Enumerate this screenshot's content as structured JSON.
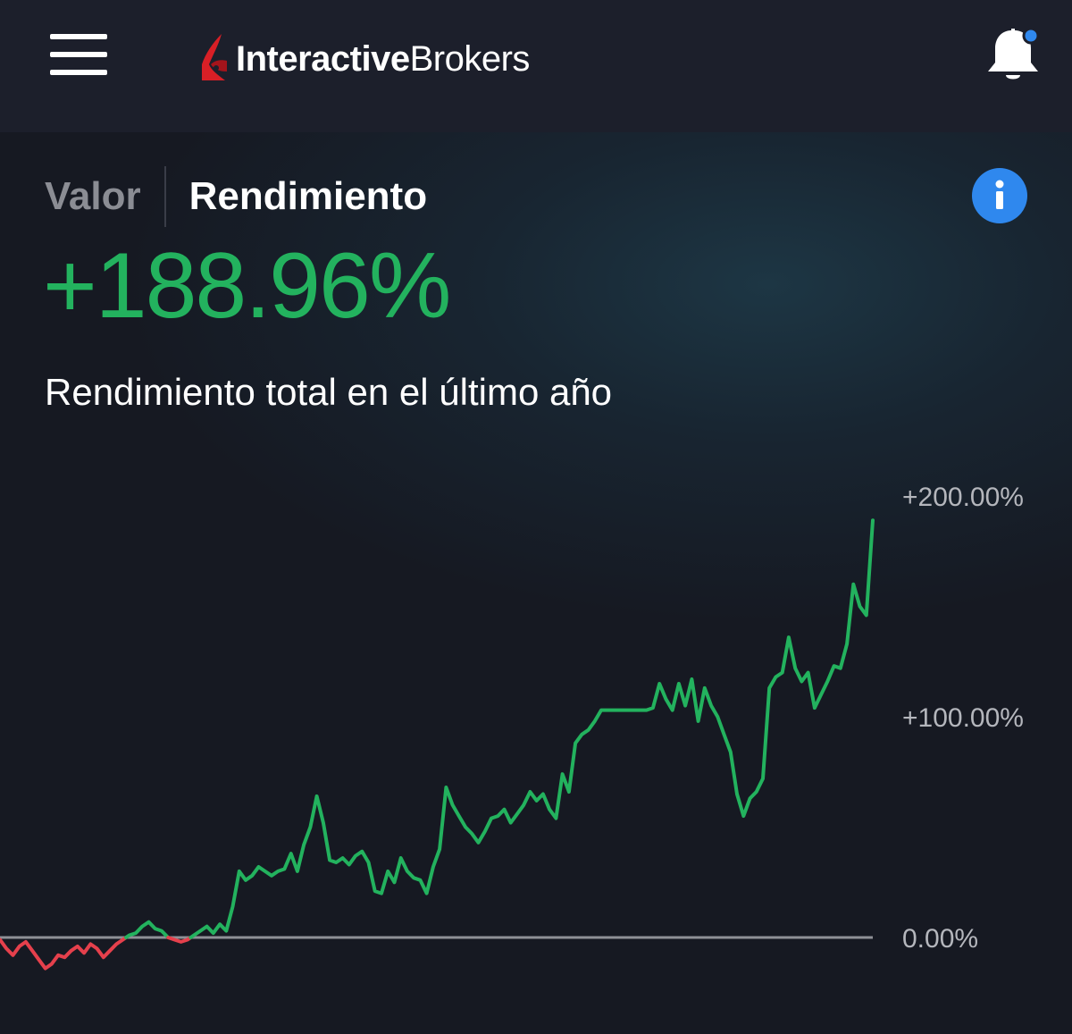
{
  "header": {
    "menu_icon": "hamburger-menu-icon",
    "logo_brand_bold": "Interactive",
    "logo_brand_regular": "Brokers",
    "notification_icon": "bell-icon",
    "notification_has_unread": true
  },
  "tabs": [
    {
      "label": "Valor",
      "active": false
    },
    {
      "label": "Rendimiento",
      "active": true
    }
  ],
  "info_icon": "info-icon",
  "performance": {
    "value": "+188.96%",
    "subtitle": "Rendimiento total en el último año"
  },
  "colors": {
    "positive": "#23b25e",
    "negative": "#e5404c",
    "baseline": "#8e9096",
    "info": "#2f88ee",
    "logo_red": "#d81f26"
  },
  "chart_data": {
    "type": "line",
    "y_ticks": [
      {
        "value": 200,
        "label": "+200.00%"
      },
      {
        "value": 100,
        "label": "+100.00%"
      },
      {
        "value": 0,
        "label": "0.00%"
      }
    ],
    "ylim": [
      -20,
      200
    ],
    "baseline": 0,
    "series": [
      {
        "values": [
          -1,
          -5,
          -8,
          -4,
          -2,
          -6,
          -10,
          -14,
          -12,
          -8,
          -9,
          -6,
          -4,
          -7,
          -3,
          -5,
          -9,
          -6,
          -3,
          -1,
          1,
          2,
          5,
          7,
          4,
          3,
          0,
          -1,
          -2,
          -1,
          1,
          3,
          5,
          2,
          6,
          3,
          14,
          30,
          26,
          28,
          32,
          30,
          28,
          30,
          31,
          38,
          30,
          42,
          50,
          64,
          52,
          35,
          34,
          36,
          33,
          37,
          39,
          34,
          21,
          20,
          30,
          25,
          36,
          30,
          27,
          26,
          20,
          32,
          40,
          68,
          60,
          55,
          50,
          47,
          43,
          48,
          54,
          55,
          58,
          52,
          56,
          60,
          66,
          62,
          65,
          58,
          54,
          74,
          66,
          88,
          92,
          94,
          98,
          103,
          103,
          103,
          103,
          103,
          103,
          103,
          103,
          104,
          115,
          108,
          103,
          115,
          105,
          117,
          98,
          113,
          105,
          100,
          92,
          84,
          65,
          55,
          63,
          66,
          72,
          113,
          118,
          120,
          136,
          122,
          116,
          120,
          104,
          110,
          116,
          123,
          122,
          133,
          160,
          150,
          146,
          189
        ]
      }
    ]
  }
}
